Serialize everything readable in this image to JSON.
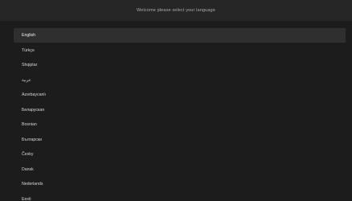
{
  "header": {
    "title": "Welcome please select your language"
  },
  "languages": {
    "selected": "English",
    "items": [
      "English",
      "Türkçe",
      "Shqiptar",
      "عربية",
      "Azərbaycanlı",
      "Беларуская",
      "Bosnian",
      "Български",
      "Česky",
      "Dansk",
      "Nederlands",
      "Eesti"
    ]
  },
  "colors": {
    "background": "#1c1c1c",
    "header_bar": "#262626",
    "selected_row": "#2f2f2f",
    "text": "#d6d6d6",
    "title_text": "#a9a9a9"
  }
}
